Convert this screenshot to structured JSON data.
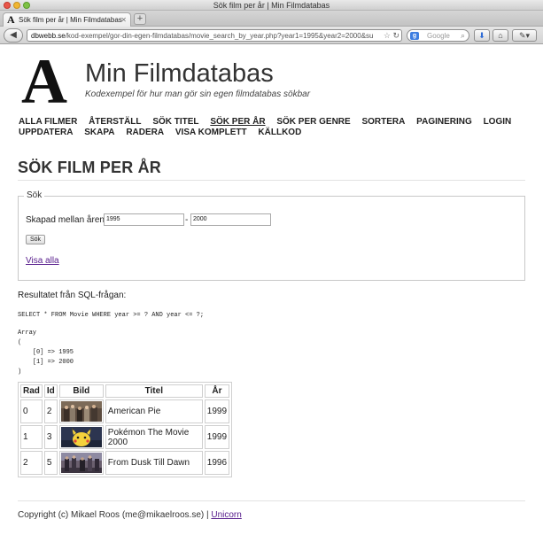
{
  "browser": {
    "window_title": "Sök film per år | Min Filmdatabas",
    "tab_title": "Sök film per år | Min Filmdatabas",
    "url_domain": "dbwebb.se",
    "url_path": "/kod-exempel/gor-din-egen-filmdatabas/movie_search_by_year.php?year1=1995&year2=2000&su",
    "search_placeholder": "Google"
  },
  "header": {
    "logo_letter": "A",
    "site_title": "Min Filmdatabas",
    "slogan": "Kodexempel för hur man gör sin egen filmdatabas sökbar"
  },
  "nav": {
    "items": [
      "ALLA FILMER",
      "ÅTERSTÄLL",
      "SÖK TITEL",
      "SÖK PER ÅR",
      "SÖK PER GENRE",
      "SORTERA",
      "PAGINERING",
      "LOGIN",
      "UPPDATERA",
      "SKAPA",
      "RADERA",
      "VISA KOMPLETT",
      "KÄLLKOD"
    ],
    "selected": "SÖK PER ÅR"
  },
  "main": {
    "heading": "SÖK FILM PER ÅR",
    "form": {
      "legend": "Sök",
      "year_label": "Skapad mellan åren:",
      "year1": "1995",
      "separator": "-",
      "year2": "2000",
      "submit_label": "Sök",
      "show_all_label": "Visa alla"
    },
    "result_label": "Resultatet från SQL-frågan:",
    "sql": "SELECT * FROM Movie WHERE year >= ? AND year <= ?;",
    "params": "Array\n(\n    [0] => 1995\n    [1] => 2000\n)",
    "table": {
      "headers": [
        "Rad",
        "Id",
        "Bild",
        "Titel",
        "År"
      ],
      "rows": [
        {
          "rad": "0",
          "id": "2",
          "image": "american-pie-poster",
          "titel": "American Pie",
          "ar": "1999"
        },
        {
          "rad": "1",
          "id": "3",
          "image": "pokemon-movie-poster",
          "titel": "Pokémon The Movie 2000",
          "ar": "1999"
        },
        {
          "rad": "2",
          "id": "5",
          "image": "from-dusk-till-dawn-poster",
          "titel": "From Dusk Till Dawn",
          "ar": "1996"
        }
      ]
    }
  },
  "footer": {
    "copyright": "Copyright (c) Mikael Roos (me@mikaelroos.se) | ",
    "link": "Unicorn"
  }
}
